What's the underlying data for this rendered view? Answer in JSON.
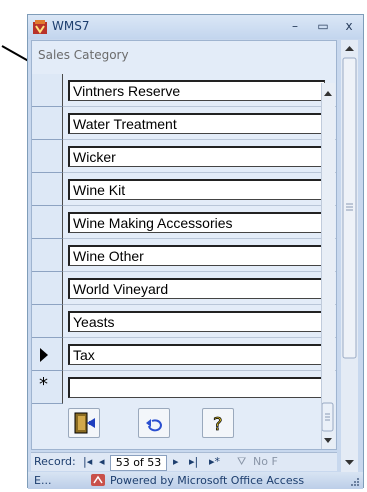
{
  "window": {
    "title": "WMS7",
    "minimize": "–",
    "restore": "▭",
    "close": "x"
  },
  "form": {
    "header_label": "Sales Category",
    "rows": [
      {
        "value": "Vintners Reserve"
      },
      {
        "value": "Water Treatment"
      },
      {
        "value": "Wicker"
      },
      {
        "value": "Wine Kit"
      },
      {
        "value": "Wine Making Accessories"
      },
      {
        "value": "Wine Other"
      },
      {
        "value": "World Vineyard"
      },
      {
        "value": "Yeasts"
      },
      {
        "value": "Tax",
        "current": true
      },
      {
        "value": "",
        "new_record": true
      }
    ],
    "new_record_marker": "*"
  },
  "buttons": {
    "close_form_icon": "exit-door-icon",
    "undo_icon": "undo-icon",
    "help_icon": "help-question-icon"
  },
  "navigator": {
    "label": "Record:",
    "first": "|◂",
    "prev": "◂",
    "position": "53 of 53",
    "next": "▸",
    "last": "▸|",
    "new": "▸*",
    "filter": "No F"
  },
  "status": {
    "left": "E...",
    "right": "Powered by Microsoft Office Access"
  },
  "colors": {
    "accent": "#1d3e6e",
    "form_bg": "#e3ecf8",
    "frame": "#c8d8ee"
  }
}
